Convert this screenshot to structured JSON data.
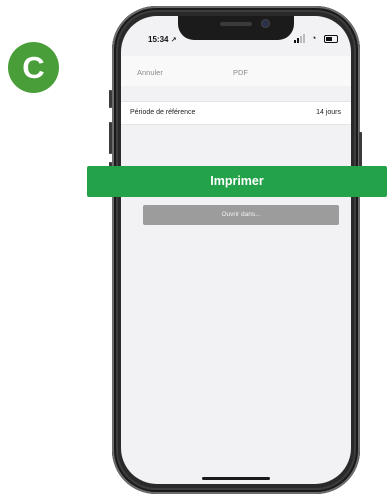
{
  "step_badge": "C",
  "status_bar": {
    "time": "15:34"
  },
  "nav": {
    "cancel_label": "Annuler",
    "title": "PDF"
  },
  "reference_period": {
    "label": "Période de référence",
    "value": "14 jours"
  },
  "open_in_label": "Ouvrir dans...",
  "print_label": "Imprimer",
  "colors": {
    "print_button": "#23a24a",
    "badge": "#4a9e3a",
    "open_button": "#9c9c9c"
  }
}
